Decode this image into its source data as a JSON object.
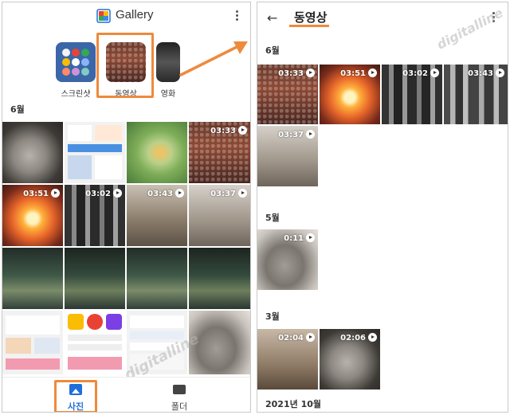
{
  "left_screen": {
    "app_title": "Gallery",
    "albums": [
      {
        "label": "스크린샷"
      },
      {
        "label": "동영상"
      },
      {
        "label": "영화"
      }
    ],
    "section_label": "6월",
    "video_durations": {
      "r1c4": "03:33",
      "r2c1": "03:51",
      "r2c2": "03:02",
      "r2c3": "03:43",
      "r2c4": "03:37"
    },
    "bottom_nav": {
      "photos_label": "사진",
      "folders_label": "폴더"
    },
    "watermark": "digitalline"
  },
  "right_screen": {
    "title": "동영상",
    "sections": [
      {
        "label": "6월"
      },
      {
        "label": "5월"
      },
      {
        "label": "3월"
      },
      {
        "label": "2021년 10월"
      }
    ],
    "june_durations": [
      "03:33",
      "03:51",
      "03:02",
      "03:43",
      "03:37"
    ],
    "may_durations": [
      "0:11"
    ],
    "march_durations": [
      "02:04",
      "02:06"
    ],
    "watermark": "digitalline"
  },
  "colors": {
    "highlight": "#ee8a3c",
    "nav_active": "#1e6fd9"
  }
}
